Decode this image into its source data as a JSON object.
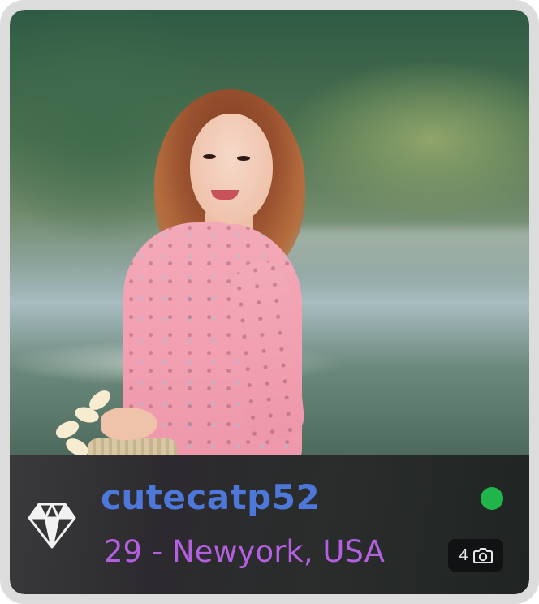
{
  "profile": {
    "username": "cutecatp52",
    "age_location": "29 - Newyork, USA",
    "photo_count": "4",
    "status": "online",
    "badge_icon": "diamond-icon",
    "photo_icon": "camera-icon"
  },
  "colors": {
    "username": "#4d78d9",
    "age_location": "#b25fe0",
    "online": "#20b54b",
    "frame": "#dcdcdc",
    "info_bar": "#2c2a2e"
  }
}
